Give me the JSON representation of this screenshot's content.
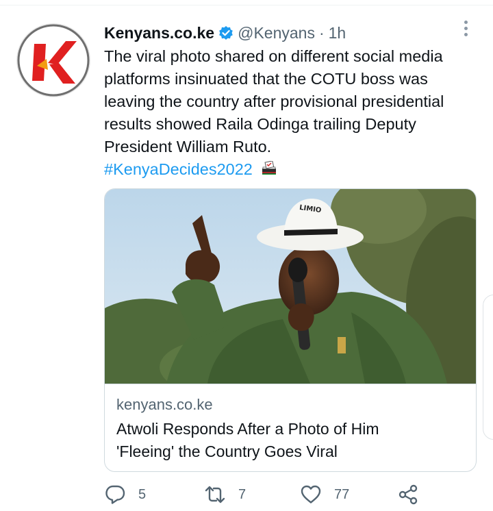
{
  "tweet": {
    "author": {
      "display_name": "Kenyans.co.ke",
      "handle": "@Kenyans",
      "verified": true,
      "avatar_icon": "kenyans-logo-icon"
    },
    "separator": "·",
    "time": "1h",
    "text_lines": [
      "The viral photo shared on different social media",
      "platforms insinuated that the COTU boss was",
      "leaving the country after provisional presidential",
      "results showed Raila Odinga trailing Deputy",
      "President William Ruto."
    ],
    "hashtag": "#KenyaDecides2022",
    "hashtag_emoji": "ballot-box-icon",
    "card": {
      "image_alt": "Man in white hat speaking into microphone",
      "hat_text": "LIMIO",
      "domain": "kenyans.co.ke",
      "title_lines": [
        "Atwoli Responds After a Photo of Him",
        "'Fleeing' the Country Goes Viral"
      ]
    },
    "actions": {
      "replies": "5",
      "retweets": "7",
      "likes": "77"
    }
  },
  "colors": {
    "accent": "#1d9bf0",
    "muted_text": "#536471",
    "brand_red": "#e02020"
  }
}
